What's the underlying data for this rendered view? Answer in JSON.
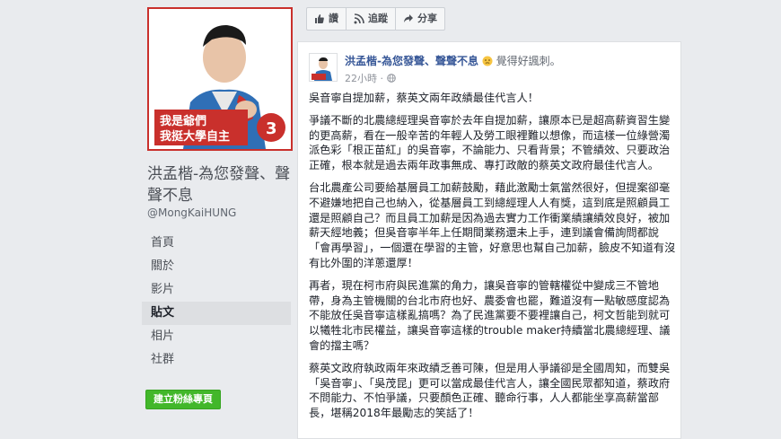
{
  "page": {
    "name": "洪孟楷-為您發聲、聲聲不息",
    "handle": "@MongKaiHUNG",
    "avatar_text_line1": "我是爺們",
    "avatar_text_line2": "我挺大學自主"
  },
  "nav": {
    "items": [
      "首頁",
      "關於",
      "影片",
      "貼文",
      "相片",
      "社群"
    ],
    "active_index": 3
  },
  "create_page_button": "建立粉絲專頁",
  "actions": {
    "like": "讚",
    "follow": "追蹤",
    "share": "分享"
  },
  "post": {
    "author": "洪孟楷-為您發聲、聲聲不息",
    "feeling": "覺得好諷刺。",
    "time": "22小時",
    "paragraphs": [
      "吳音寧自提加薪，蔡英文兩年政績最佳代言人！",
      "爭議不斷的北農總經理吳音寧於去年自提加薪，讓原本已是超高薪資習生變的更高薪，看在一般辛苦的年輕人及勞工眼裡難以想像，而這樣一位綠營濁派色彩「根正苗紅」的吳音寧，不論能力、只看背景；不管績效、只要政治正確，根本就是過去兩年政事無成、專打政敵的蔡英文政府最佳代言人。",
      "台北農產公司要給基層員工加薪鼓勵，藉此激勵士氣當然很好，但提案卻毫不避嫌地把自己也納入，從基層員工到總經理人人有獎，這到底是照顧員工還是照顧自己？而且員工加薪是因為過去實力工作衝業績讓績效良好，被加薪天經地義；但吳音寧半年上任期間業務還未上手，連到議會備詢問都說「會再學習」，一個還在學習的主管，好意思也幫自己加薪，臉皮不知道有沒有比外圍的洋蔥還厚！",
      "再者，現在柯市府與民進黨的角力，讓吳音寧的管轄權從中變成三不管地帶，身為主管機關的台北市府也好、農委會也罷，難道沒有一點敏感度認為不能放任吳音寧這樣亂搞嗎？為了民進黨要不要裡讓自己，柯文哲能到就可以犧牲北市民權益，讓吳音寧這樣的trouble maker持續當北農總經理、議會的擋主嗎？",
      "蔡英文政府執政兩年來政績乏善可陳，但是用人爭議卻是全國周知，而雙吳「吳音寧」、「吳茂昆」更可以當成最佳代言人，讓全國民眾都知道，蔡政府不問能力、不怕爭議，只要顏色正確、聽命行事，人人都能坐享高薪當部長，堪稱2018年最勵志的笑話了！"
    ]
  },
  "colors": {
    "accent_red": "#c9302c",
    "link_blue": "#385898",
    "green_button": "#42b72a"
  }
}
